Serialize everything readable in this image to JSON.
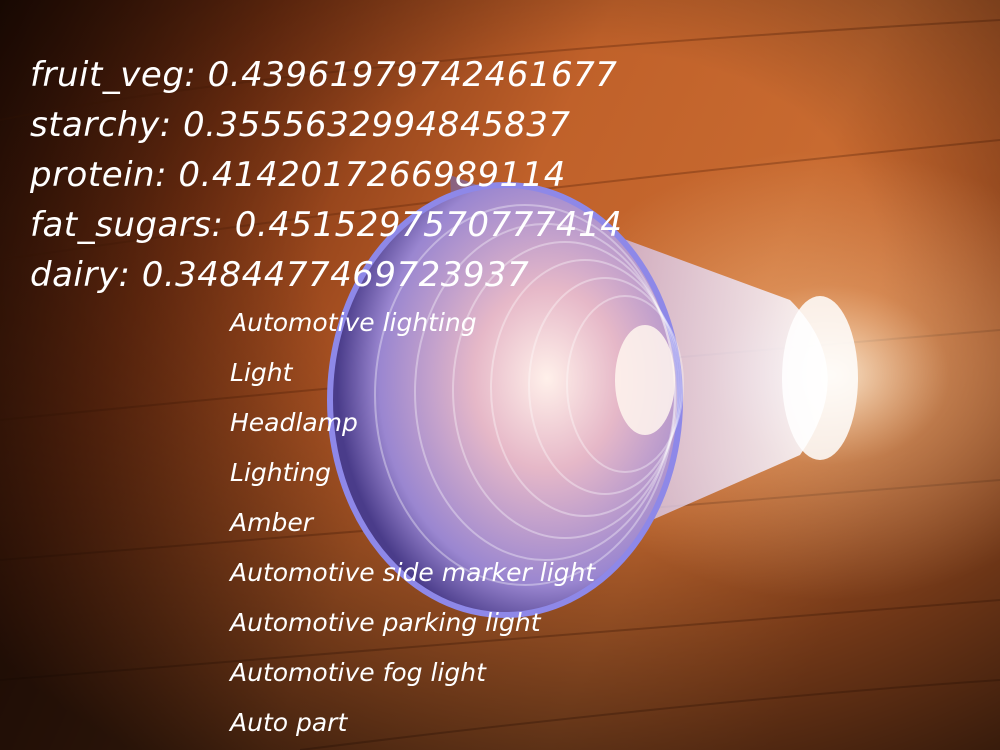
{
  "scores": [
    {
      "name": "fruit_veg",
      "value": "0.43961979742461677"
    },
    {
      "name": "starchy",
      "value": "0.3555632994845837"
    },
    {
      "name": "protein",
      "value": "0.4142017266989114"
    },
    {
      "name": "fat_sugars",
      "value": "0.4515297570777414"
    },
    {
      "name": "dairy",
      "value": "0.3484477469723937"
    }
  ],
  "labels": [
    "Automotive lighting",
    "Light",
    "Headlamp",
    "Lighting",
    "Amber",
    "Automotive side marker light",
    "Automotive parking light",
    "Automotive fog light",
    "Auto part"
  ],
  "colors": {
    "wood_light": "#c8652a",
    "wood_dark": "#2a0e04",
    "cup_rim": "#8e88e8",
    "text": "#ffffff"
  }
}
